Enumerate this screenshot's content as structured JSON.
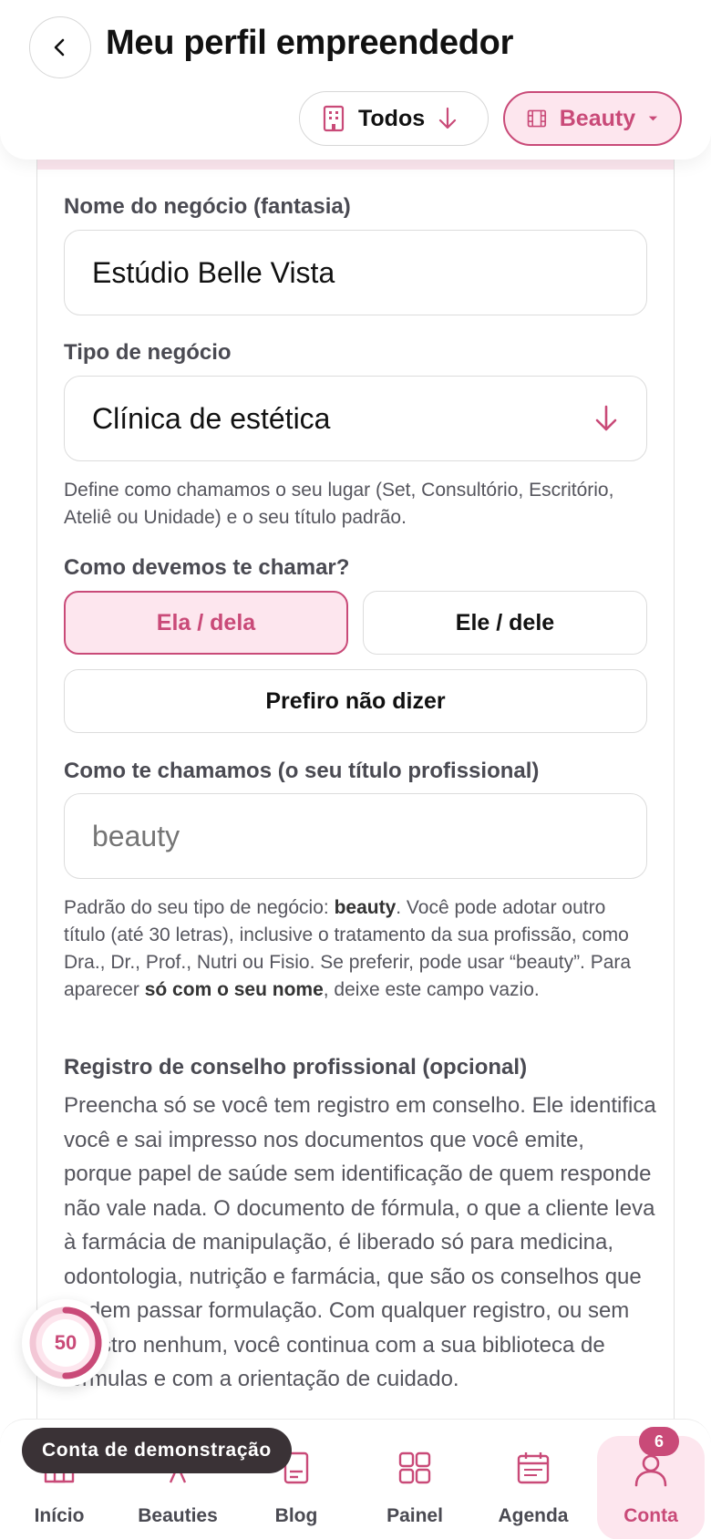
{
  "header": {
    "title": "Meu perfil empreendedor",
    "filter_todos": "Todos",
    "filter_beauty": "Beauty"
  },
  "form": {
    "business_name_label": "Nome do negócio (fantasia)",
    "business_name_value": "Estúdio Belle Vista",
    "business_type_label": "Tipo de negócio",
    "business_type_value": "Clínica de estética",
    "business_type_help": "Define como chamamos o seu lugar (Set, Consultório, Escritório, Ateliê ou Unidade) e o seu título padrão.",
    "pronoun_label": "Como devemos te chamar?",
    "pronoun_options": [
      "Ela / dela",
      "Ele / dele",
      "Prefiro não dizer"
    ],
    "pronoun_selected": "Ela / dela",
    "title_label": "Como te chamamos (o seu título profissional)",
    "title_placeholder": "beauty",
    "title_help": {
      "p1": "Padrão do seu tipo de negócio: ",
      "b1": "beauty",
      "p2": ". Você pode adotar outro título (até 30 letras), inclusive o tratamento da sua profissão, como Dra., Dr., Prof., Nutri ou Fisio. Se preferir, pode usar “beauty”. Para aparecer ",
      "b2": "só com o seu nome",
      "p3": ", deixe este campo vazio."
    },
    "council_label": "Registro de conselho profissional (opcional)",
    "council_text": "Preencha só se você tem registro em conselho. Ele identifica você e sai impresso nos documentos que você emite, porque papel de saúde sem identificação de quem responde não vale nada. O documento de fórmula, o que a cliente leva à farmácia de manipulação, é liberado só para medicina, odontologia, nutrição e farmácia, que são os conselhos que podem passar formulação. Com qualquer registro, ou sem registro nenhum, você continua com a sua biblioteca de fórmulas e com a orientação de cuidado."
  },
  "progress": {
    "value": "50",
    "fraction": 0.5
  },
  "demo_toast": "Conta de demonstração",
  "nav": {
    "items": [
      {
        "label": "Início",
        "icon": "home-icon"
      },
      {
        "label": "Beauties",
        "icon": "beauties-icon"
      },
      {
        "label": "Blog",
        "icon": "blog-icon"
      },
      {
        "label": "Painel",
        "icon": "grid-icon"
      },
      {
        "label": "Agenda",
        "icon": "calendar-icon"
      },
      {
        "label": "Conta",
        "icon": "user-icon"
      }
    ],
    "active": "Conta",
    "badge_count": "6"
  },
  "colors": {
    "accent": "#c94a78",
    "accent_light": "#fde6ee",
    "text_muted": "#55555d"
  }
}
